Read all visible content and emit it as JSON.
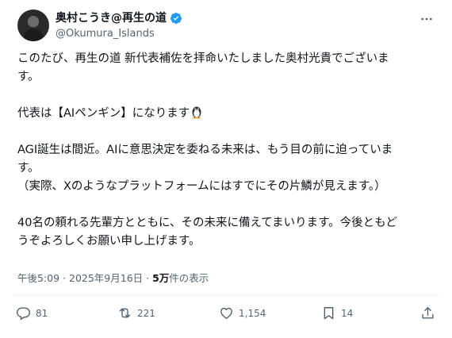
{
  "author": {
    "name": "奥村こうき@再生の道",
    "handle": "@Okumura_Islands",
    "verified": true
  },
  "post": {
    "line1": "このたび、再生の道 新代表補佐を拝命いたしました奥村光貴でございま",
    "line2": "す。",
    "line3": "代表は【AIペンギン】になります",
    "line4": "AGI誕生は間近。AIに意思決定を委ねる未来は、もう目の前に迫っていま",
    "line5": "す。",
    "line6": "（実際、Xのようなプラットフォームにはすでにその片鱗が見えます。）",
    "line7": "40名の頼れる先輩方とともに、その未来に備えてまいります。今後ともど",
    "line8": "うぞよろしくお願い申し上げます。"
  },
  "meta": {
    "time": "午後5:09",
    "date": "2025年9月16日",
    "views": "5万",
    "views_label": "件の表示",
    "separator": " · "
  },
  "actions": {
    "replies": "81",
    "reposts": "221",
    "likes": "1,154",
    "bookmarks": "14"
  },
  "colors": {
    "text": "#0f1419",
    "secondary": "#536471",
    "verified": "#1d9bf0"
  },
  "icons": [
    "verified-badge-icon",
    "more-icon",
    "penguin-emoji",
    "reply-icon",
    "repost-icon",
    "like-icon",
    "bookmark-icon",
    "share-icon"
  ]
}
